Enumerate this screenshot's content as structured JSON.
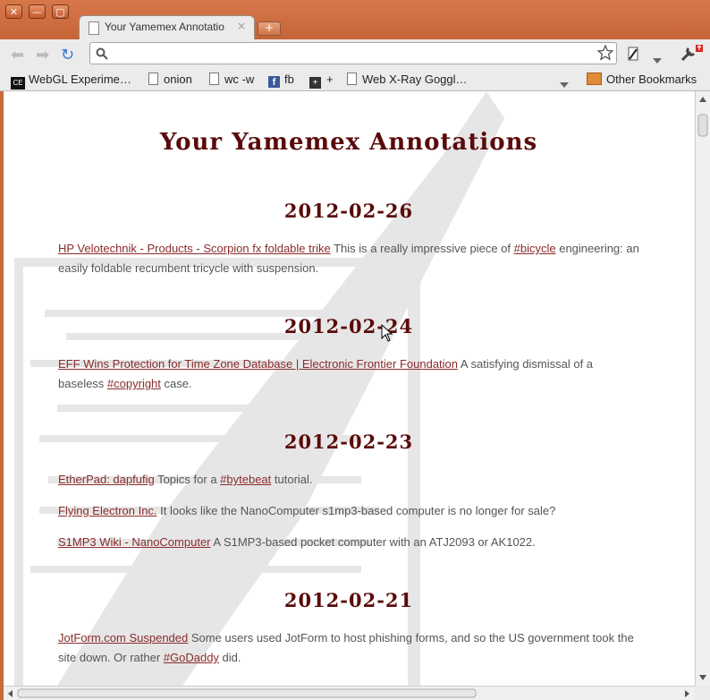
{
  "window": {
    "tab_title": "Your Yamemex Annotatio",
    "tab_close": "×",
    "new_tab": "+",
    "close_btn": "✕",
    "min_btn": "—",
    "max_btn": "▢"
  },
  "bookmarks": [
    {
      "label": "WebGL Experime…",
      "icon": "ce-icon"
    },
    {
      "label": "onion",
      "icon": "page-icon"
    },
    {
      "label": "wc -w",
      "icon": "page-icon"
    },
    {
      "label": "fb",
      "icon": "facebook-icon"
    },
    {
      "label": "+",
      "icon": "plus-icon"
    },
    {
      "label": "Web X-Ray Goggl…",
      "icon": "page-icon"
    }
  ],
  "other_bookmarks": "Other Bookmarks",
  "page": {
    "title": "Your Yamemex Annotations",
    "sections": [
      {
        "date": "2012-02-26",
        "entries": [
          {
            "link": "HP Velotechnik - Products - Scorpion fx foldable trike",
            "text1": " This is a really impressive piece of ",
            "tag": "#bicycle",
            "text2": " engineering: an easily foldable recumbent tricycle with suspension."
          }
        ]
      },
      {
        "date": "2012-02-24",
        "entries": [
          {
            "link": "EFF Wins Protection for Time Zone Database | Electronic Frontier Foundation",
            "text1": " A satisfying dismissal of a baseless ",
            "tag": "#copyright",
            "text2": " case."
          }
        ]
      },
      {
        "date": "2012-02-23",
        "entries": [
          {
            "link": "EtherPad: dapfufig",
            "text1": " Topics for a ",
            "tag": "#bytebeat",
            "text2": " tutorial."
          },
          {
            "link": "Flying Electron Inc.",
            "text1": " It looks like the NanoComputer s1mp3-based computer is no longer for sale?",
            "tag": "",
            "text2": ""
          },
          {
            "link": "S1MP3 Wiki - NanoComputer",
            "text1": " A S1MP3-based pocket computer with an ATJ2093 or AK1022.",
            "tag": "",
            "text2": ""
          }
        ]
      },
      {
        "date": "2012-02-21",
        "entries": [
          {
            "link": "JotForm.com Suspended",
            "text1": " Some users used JotForm to host phishing forms, and so the US government took the site down. Or rather ",
            "tag": "#GoDaddy",
            "text2": " did."
          }
        ]
      }
    ]
  },
  "colors": {
    "frame": "#c86a3c",
    "heading": "#5a0a0a",
    "link": "#8a2b2b",
    "body_text": "#555555"
  }
}
